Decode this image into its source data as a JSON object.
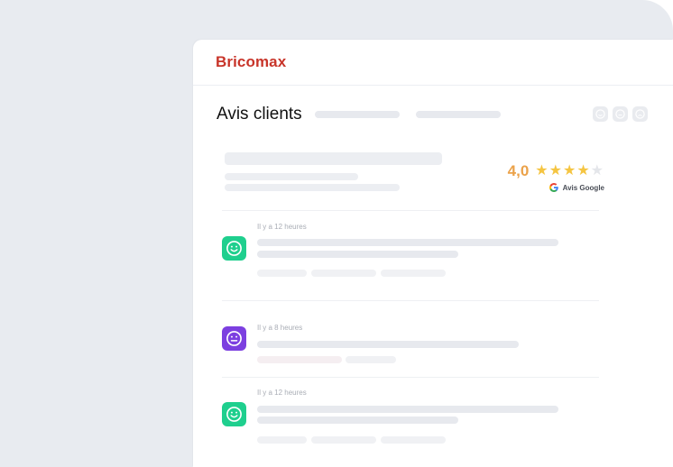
{
  "header": {
    "brand": "Bricomax"
  },
  "page": {
    "title": "Avis clients"
  },
  "summary": {
    "score": "4,0",
    "stars_filled": 4,
    "stars_total": 5,
    "source": "Avis Google"
  },
  "reviews": [
    {
      "time": "Il y a 12 heures",
      "sentiment": "positive",
      "avatar_color": "#1fcf8e"
    },
    {
      "time": "Il y a 8 heures",
      "sentiment": "neutral",
      "avatar_color": "#7c3fe0"
    },
    {
      "time": "Il y a 12 heures",
      "sentiment": "positive",
      "avatar_color": "#1fcf8e"
    }
  ],
  "toolbar_icons": [
    "smile-icon",
    "neutral-face-icon",
    "sad-face-icon"
  ],
  "colors": {
    "brand": "#c8352a",
    "rating": "#eba24a",
    "star": "#f5c542",
    "positive": "#1fcf8e",
    "neutral": "#7c3fe0"
  }
}
